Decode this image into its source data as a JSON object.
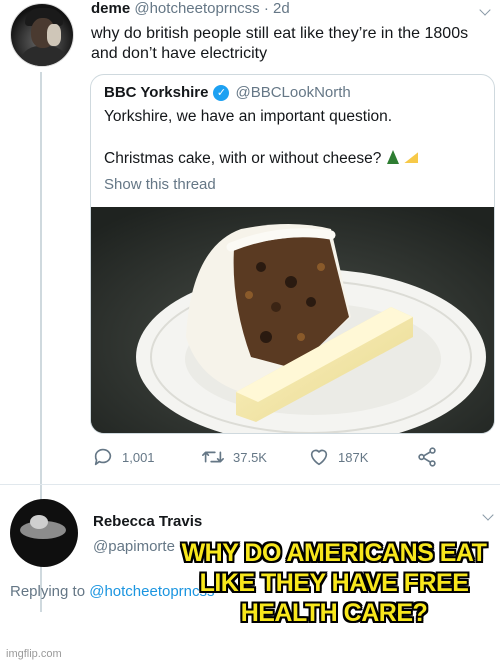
{
  "tweet": {
    "name": "deme",
    "handle": "@hotcheetoprncss",
    "separator": "·",
    "time": "2d",
    "text": "why do british people still eat like they’re in the 1800s and don’t have electricity",
    "quote": {
      "name": "BBC Yorkshire",
      "handle": "@BBCLookNorth",
      "line1": "Yorkshire, we have an important question.",
      "line2": "Christmas cake, with or without cheese?",
      "show_thread": "Show this thread"
    },
    "stats": {
      "replies": "1,001",
      "retweets": "37.5K",
      "likes": "187K"
    }
  },
  "reply_tweet": {
    "name": "Rebecca Travis",
    "handle": "@papimorte",
    "replying_to_prefix": "Replying to",
    "replying_to_handle": "@hotcheetoprncss"
  },
  "meme_caption": "WHY DO AMERICANS EAT LIKE THEY HAVE FREE HEALTH CARE?",
  "watermark": "imgflip.com",
  "colors": {
    "link": "#1b95e0",
    "verified": "#1da1f2",
    "caption": "#f8e71c",
    "muted": "#657786"
  },
  "icons": [
    "reply-icon",
    "retweet-icon",
    "like-icon",
    "share-icon",
    "verified-icon",
    "chevron-down-icon",
    "tree-emoji",
    "cheese-emoji"
  ]
}
